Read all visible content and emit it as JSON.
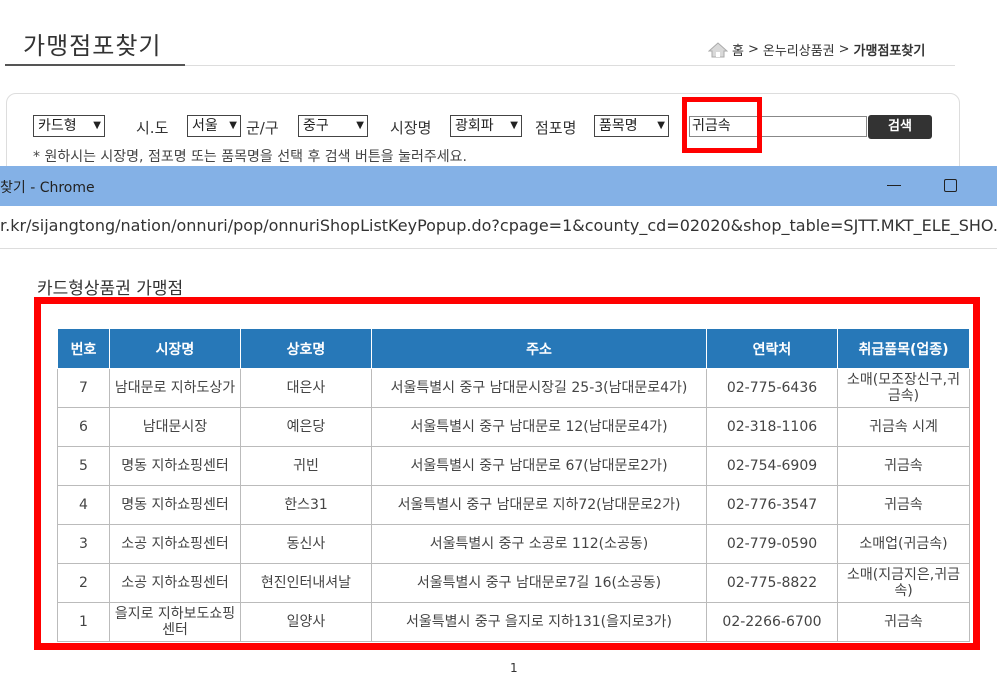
{
  "page": {
    "title": "가맹점포찾기",
    "breadcrumb": {
      "home": "홈",
      "sep": ">",
      "section": "온누리상품권",
      "current": "가맹점포찾기"
    }
  },
  "search": {
    "type_select": "카드형",
    "city_label": "시.도",
    "city_select": "서울",
    "district_label": "군/구",
    "district_select": "중구",
    "market_label": "시장명",
    "market_select": "광회파",
    "shop_label": "점포명",
    "shop_select": "품목명",
    "keyword_value": "귀금속",
    "search_button": "검색",
    "hint": "* 원하시는 시장명, 점포명 또는 품목명을 선택 후 검색 버튼을 눌러주세요."
  },
  "popup": {
    "window_title": "찾기 - Chrome",
    "url": "r.kr/sijangtong/nation/onnuri/pop/onnuriShopListKeyPopup.do?cpage=1&county_cd=02020&shop_table=SJTT.MKT_ELE_SHO...",
    "section_title": "카드형상품권 가맹점",
    "table": {
      "headers": [
        "번호",
        "시장명",
        "상호명",
        "주소",
        "연락처",
        "취급품목(업종)"
      ],
      "rows": [
        [
          "7",
          "남대문로 지하도상가",
          "대은사",
          "서울특별시 중구 남대문시장길 25-3(남대문로4가)",
          "02-775-6436",
          "소매(모조장신구,귀금속)"
        ],
        [
          "6",
          "남대문시장",
          "예은당",
          "서울특별시 중구 남대문로 12(남대문로4가)",
          "02-318-1106",
          "귀금속 시계"
        ],
        [
          "5",
          "명동 지하쇼핑센터",
          "귀빈",
          "서울특별시 중구 남대문로 67(남대문로2가)",
          "02-754-6909",
          "귀금속"
        ],
        [
          "4",
          "명동 지하쇼핑센터",
          "한스31",
          "서울특별시 중구 남대문로 지하72(남대문로2가)",
          "02-776-3547",
          "귀금속"
        ],
        [
          "3",
          "소공 지하쇼핑센터",
          "동신사",
          "서울특별시 중구 소공로 112(소공동)",
          "02-779-0590",
          "소매업(귀금속)"
        ],
        [
          "2",
          "소공 지하쇼핑센터",
          "현진인터내셔날",
          "서울특별시 중구 남대문로7길 16(소공동)",
          "02-775-8822",
          "소매(지금지은,귀금속)"
        ],
        [
          "1",
          "을지로 지하보도쇼핑센터",
          "일양사",
          "서울특별시 중구 을지로 지하131(을지로3가)",
          "02-2266-6700",
          "귀금속"
        ]
      ]
    },
    "pager": "1"
  }
}
